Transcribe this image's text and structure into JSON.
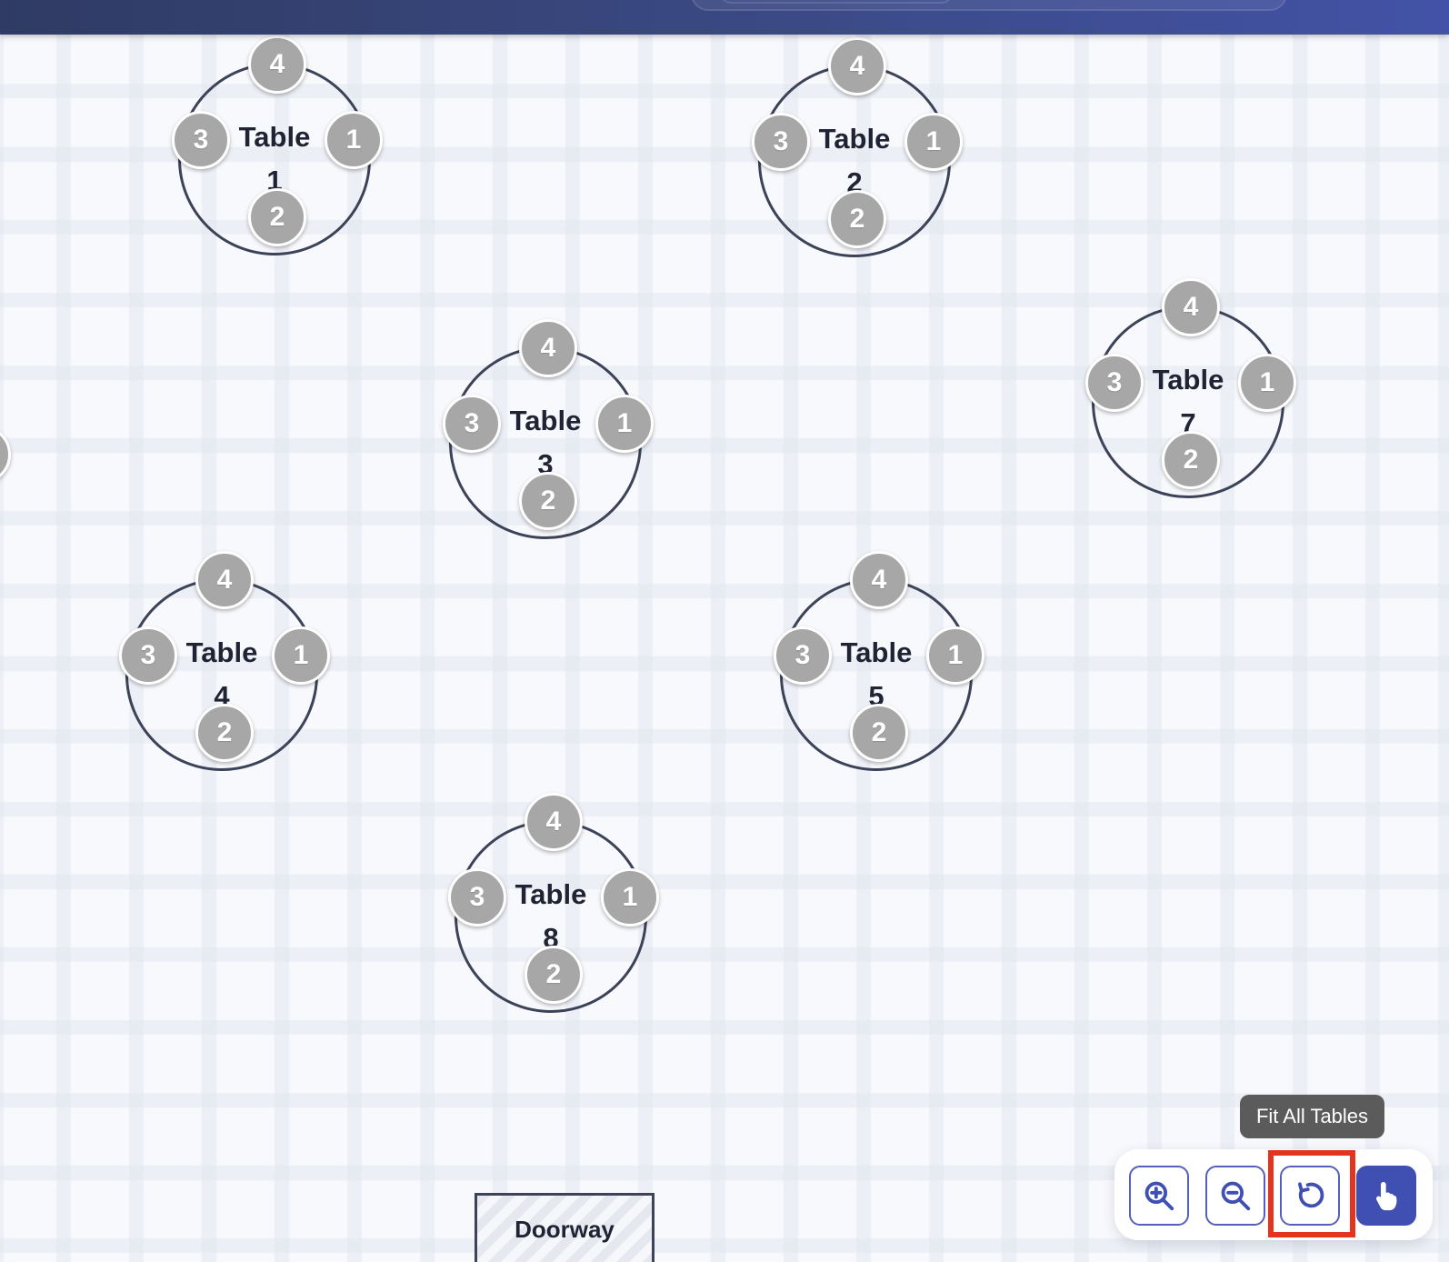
{
  "tables": [
    {
      "id": "table-1",
      "label_word": "Table",
      "label_num": "1",
      "seats": [
        "4",
        "1",
        "2",
        "3"
      ]
    },
    {
      "id": "table-2",
      "label_word": "Table",
      "label_num": "2",
      "seats": [
        "4",
        "1",
        "2",
        "3"
      ]
    },
    {
      "id": "table-3",
      "label_word": "Table",
      "label_num": "3",
      "seats": [
        "4",
        "1",
        "2",
        "3"
      ]
    },
    {
      "id": "table-7",
      "label_word": "Table",
      "label_num": "7",
      "seats": [
        "4",
        "1",
        "2",
        "3"
      ]
    },
    {
      "id": "table-4",
      "label_word": "Table",
      "label_num": "4",
      "seats": [
        "4",
        "1",
        "2",
        "3"
      ]
    },
    {
      "id": "table-5",
      "label_word": "Table",
      "label_num": "5",
      "seats": [
        "4",
        "1",
        "2",
        "3"
      ]
    },
    {
      "id": "table-8",
      "label_word": "Table",
      "label_num": "8",
      "seats": [
        "4",
        "1",
        "2",
        "3"
      ]
    }
  ],
  "doorway": {
    "label": "Doorway"
  },
  "tooltip": {
    "text": "Fit All Tables"
  },
  "toolbar": {
    "zoom_in_icon": "zoom-in-icon",
    "zoom_out_icon": "zoom-out-icon",
    "fit_icon": "refresh-icon",
    "pan_icon": "hand-pointer-icon"
  },
  "colors": {
    "accent": "#3f4fb2",
    "highlight": "#e2341f",
    "seat": "#a7a7a7",
    "table_outline": "#3c4257"
  }
}
